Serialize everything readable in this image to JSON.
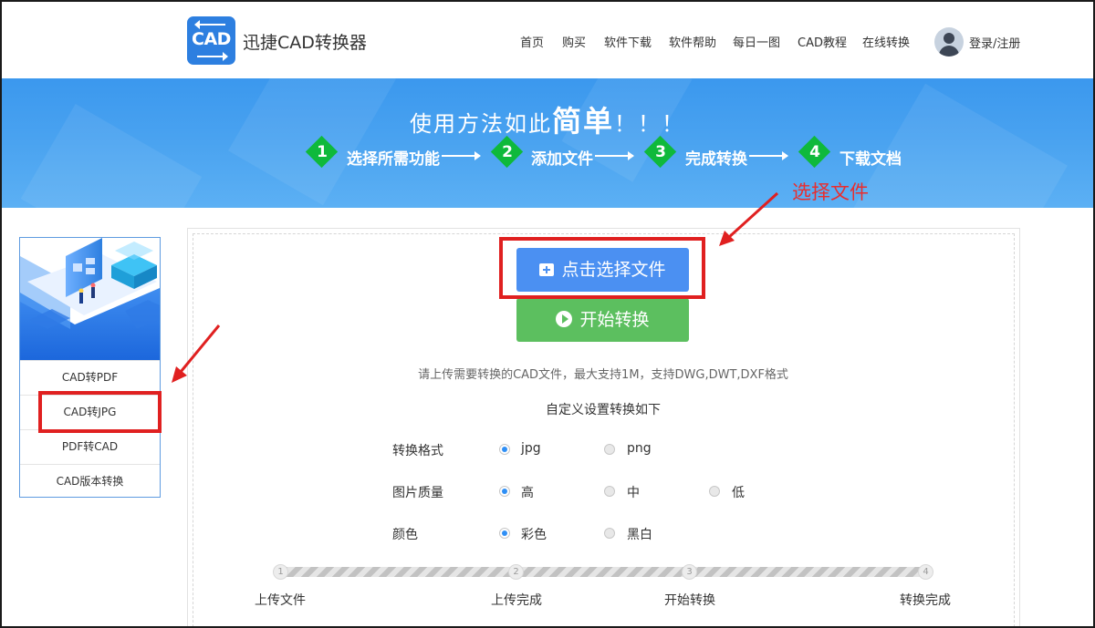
{
  "brand": {
    "logo_text": "CAD",
    "name": "迅捷CAD转换器"
  },
  "nav": [
    "首页",
    "购买",
    "软件下载",
    "软件帮助",
    "每日一图",
    "CAD教程",
    "在线转换"
  ],
  "user": {
    "login_label": "登录/注册"
  },
  "banner": {
    "title_prefix": "使用方法如此",
    "title_highlight": "简单",
    "title_suffix": "！！！",
    "steps": [
      {
        "num": "1",
        "label": "选择所需功能"
      },
      {
        "num": "2",
        "label": "添加文件"
      },
      {
        "num": "3",
        "label": "完成转换"
      },
      {
        "num": "4",
        "label": "下载文档"
      }
    ]
  },
  "annotation": {
    "label": "选择文件"
  },
  "sidebar": {
    "items": [
      "CAD转PDF",
      "CAD转JPG",
      "PDF转CAD",
      "CAD版本转换"
    ]
  },
  "main": {
    "select_button": "点击选择文件",
    "start_button": "开始转换",
    "hint": "请上传需要转换的CAD文件，最大支持1M，支持DWG,DWT,DXF格式",
    "custom_title": "自定义设置转换如下",
    "options": [
      {
        "label": "转换格式",
        "choices": [
          "jpg",
          "png"
        ],
        "selected": "jpg"
      },
      {
        "label": "图片质量",
        "choices": [
          "高",
          "中",
          "低"
        ],
        "selected": "高"
      },
      {
        "label": "颜色",
        "choices": [
          "彩色",
          "黑白"
        ],
        "selected": "彩色"
      }
    ]
  },
  "progress": {
    "steps": [
      {
        "num": "1",
        "label": "上传文件"
      },
      {
        "num": "2",
        "label": "上传完成"
      },
      {
        "num": "3",
        "label": "开始转换"
      },
      {
        "num": "4",
        "label": "转换完成"
      }
    ]
  },
  "colors": {
    "accent_blue": "#4b90f2",
    "start_green": "#5cbf5f",
    "step_green": "#0fb93b",
    "annotation_red": "#e02020",
    "banner_blue": "#3b98ee"
  }
}
